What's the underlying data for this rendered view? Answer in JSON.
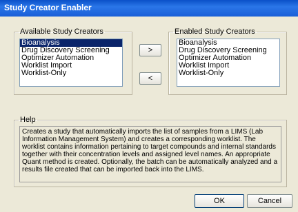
{
  "window": {
    "title": "Study Creator Enabler"
  },
  "available": {
    "legend": "Available Study Creators",
    "items": [
      "Bioanalysis",
      "Drug Discovery Screening",
      "Optimizer Automation",
      "Worklist Import",
      "Worklist-Only"
    ],
    "selected_index": 0
  },
  "enabled": {
    "legend": "Enabled Study Creators",
    "items": [
      "Bioanalysis",
      "Drug Discovery Screening",
      "Optimizer Automation",
      "Worklist Import",
      "Worklist-Only"
    ]
  },
  "move": {
    "right_label": ">",
    "left_label": "<"
  },
  "help": {
    "legend": "Help",
    "text": "Creates a study that automatically imports the list of samples from a LIMS (Lab Information Management System) and creates a corresponding worklist.  The worklist contains information pertaining to target compounds and internal standards together with their concentration levels and assigned level names.  An appropriate Quant method is created. Optionally, the batch can be automatically analyzed and a results file created that can be imported back into the LIMS."
  },
  "buttons": {
    "ok_label": "OK",
    "cancel_label": "Cancel"
  },
  "colors": {
    "title_bar": "#1a5fd8",
    "selection": "#0a246a",
    "dialog_bg": "#ece9d8"
  }
}
